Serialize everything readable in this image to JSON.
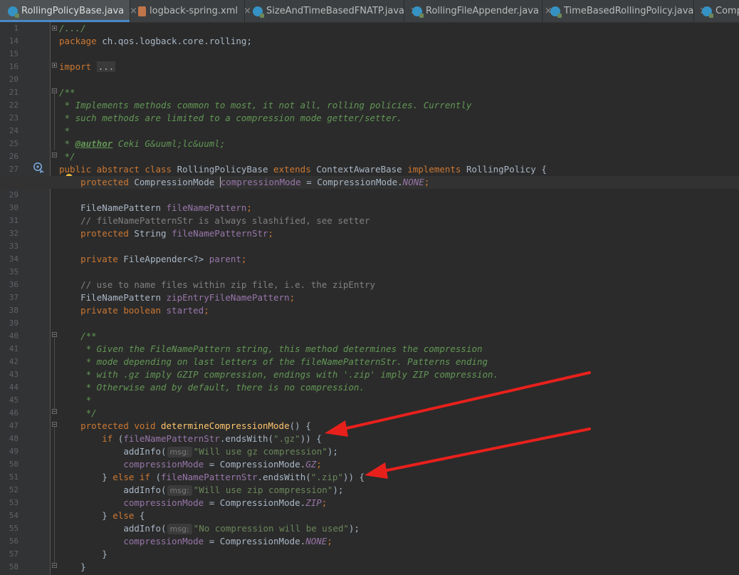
{
  "tabs": [
    {
      "label": "RollingPolicyBase.java",
      "close": "×",
      "active": true
    },
    {
      "label": "logback-spring.xml",
      "close": "×",
      "active": false
    },
    {
      "label": "SizeAndTimeBasedFNATP.java",
      "close": "×",
      "active": false
    },
    {
      "label": "RollingFileAppender.java",
      "close": "×",
      "active": false
    },
    {
      "label": "TimeBasedRollingPolicy.java",
      "close": "×",
      "active": false
    },
    {
      "label": "Compr",
      "close": "",
      "active": false
    }
  ],
  "line_numbers": [
    "1",
    "14",
    "15",
    "16",
    "20",
    "21",
    "22",
    "23",
    "24",
    "25",
    "26",
    "27",
    "28",
    "29",
    "30",
    "31",
    "32",
    "33",
    "34",
    "35",
    "36",
    "37",
    "38",
    "39",
    "40",
    "41",
    "42",
    "43",
    "44",
    "45",
    "46",
    "47",
    "48",
    "49",
    "50",
    "51",
    "52",
    "53",
    "54",
    "55",
    "56",
    "57",
    "58"
  ],
  "code": {
    "l1": "/.../",
    "l14_kw": "package",
    "l14_rest": " ch.qos.logback.core.rolling;",
    "l16_kw": "import",
    "l16_fold": "...",
    "l21": "/**",
    "l22": " * Implements methods common to most, it not all, rolling policies. Currently",
    "l23": " * such methods are limited to a compression mode getter/setter.",
    "l24": " *",
    "l25_a": " * ",
    "l25_tag": "@author",
    "l25_b": " Ceki G&uuml;lc&uuml;",
    "l26": " */",
    "l27_kw1": "public abstract class",
    "l27_name": " RollingPolicyBase ",
    "l27_kw2": "extends",
    "l27_base": " ContextAwareBase ",
    "l27_kw3": "implements",
    "l27_iface": " RollingPolicy {",
    "l28_kw": "protected",
    "l28_type": " CompressionMode ",
    "l28_field": "compressionMode",
    "l28_eq": " = CompressionMode.",
    "l28_enum": "NONE",
    "l28_end": ";",
    "l30_type": "FileNamePattern ",
    "l30_field": "fileNamePattern",
    "l30_end": ";",
    "l31": "// fileNamePatternStr is always slashified, see setter",
    "l32_kw": "protected",
    "l32_type": " String ",
    "l32_field": "fileNamePatternStr",
    "l32_end": ";",
    "l34_kw": "private",
    "l34_type": " FileAppender<?> ",
    "l34_field": "parent",
    "l34_end": ";",
    "l36": "// use to name files within zip file, i.e. the zipEntry",
    "l37_type": "FileNamePattern ",
    "l37_field": "zipEntryFileNamePattern",
    "l37_end": ";",
    "l38_kw": "private boolean",
    "l38_field": " started",
    "l38_end": ";",
    "l40": "/**",
    "l41": " * Given the FileNamePattern string, this method determines the compression",
    "l42": " * mode depending on last letters of the fileNamePatternStr. Patterns ending",
    "l43": " * with .gz imply GZIP compression, endings with '.zip' imply ZIP compression.",
    "l44": " * Otherwise and by default, there is no compression.",
    "l45": " *",
    "l46": " */",
    "l47_kw": "protected void",
    "l47_fn": " determineCompressionMode",
    "l47_end": "() {",
    "l48_kw": "if",
    "l48_a": " (",
    "l48_field": "fileNamePatternStr",
    "l48_b": ".endsWith(",
    "l48_str": "\".gz\"",
    "l48_c": ")) {",
    "l49_a": "addInfo(",
    "l49_hint": "msg:",
    "l49_str": "\"Will use gz compression\"",
    "l49_end": ");",
    "l50_field": "compressionMode",
    "l50_eq": " = CompressionMode.",
    "l50_enum": "GZ",
    "l50_end": ";",
    "l51_a": "} ",
    "l51_kw": "else if",
    "l51_b": " (",
    "l51_field": "fileNamePatternStr",
    "l51_c": ".endsWith(",
    "l51_str": "\".zip\"",
    "l51_d": ")) {",
    "l52_a": "addInfo(",
    "l52_hint": "msg:",
    "l52_str": "\"Will use zip compression\"",
    "l52_end": ");",
    "l53_field": "compressionMode",
    "l53_eq": " = CompressionMode.",
    "l53_enum": "ZIP",
    "l53_end": ";",
    "l54_a": "} ",
    "l54_kw": "else",
    "l54_b": " {",
    "l55_a": "addInfo(",
    "l55_hint": "msg:",
    "l55_str": "\"No compression will be used\"",
    "l55_end": ");",
    "l56_field": "compressionMode",
    "l56_eq": " = CompressionMode.",
    "l56_enum": "NONE",
    "l56_end": ";",
    "l57": "}",
    "l58": "}"
  },
  "icons": {
    "java_file": "java-class-icon",
    "xml_file": "xml-file-icon",
    "intention": "lightbulb-icon",
    "implements_marker": "implemented-marker-icon"
  },
  "colors": {
    "editor_bg": "#2b2b2b",
    "keyword": "#cc7832",
    "comment": "#629755",
    "field": "#9876aa",
    "string": "#6a8759",
    "method": "#ffc66d",
    "annotation_arrow": "#e8201c"
  }
}
